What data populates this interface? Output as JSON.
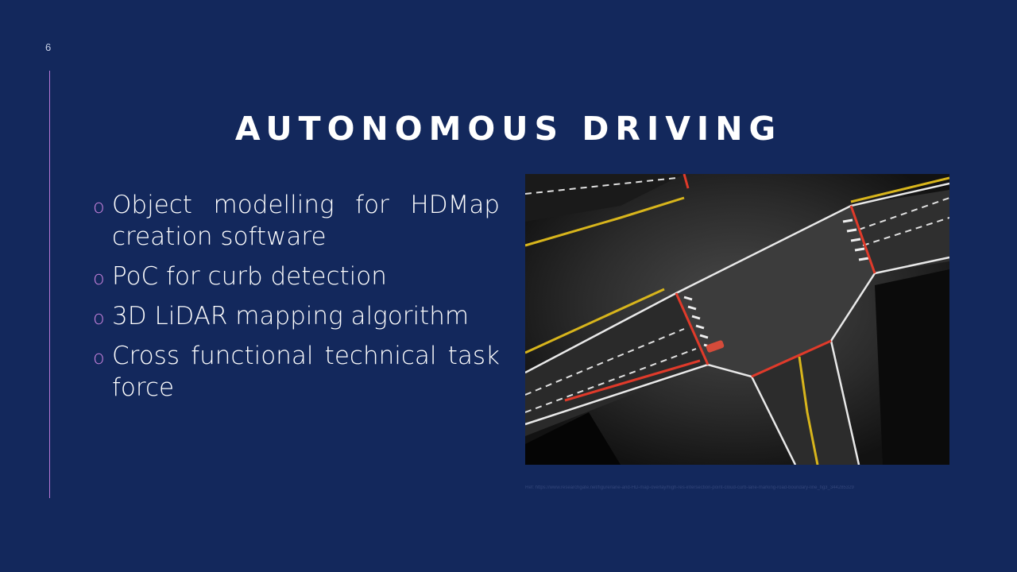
{
  "slide": {
    "page_number": "6",
    "title": "AUTONOMOUS DRIVING",
    "bullet_marker": "o",
    "bullets": [
      "Object modelling for HDMap creation software",
      "PoC for curb detection",
      "3D LiDAR mapping algorithm",
      "Cross functional technical task force"
    ],
    "reference": "Ref: https://www.researchgate.net/figure/lane-and-HD-map-overlay/high-res-intersection-point-cloud-curb-lane-marking-road-boundary-line_fig3_344285329"
  },
  "colors": {
    "background": "#13285c",
    "accent_line": "#b777d6",
    "bullet_marker": "#c17fd8",
    "text": "#ffffff",
    "lane_yellow": "#d8b51c",
    "curb_red": "#e03a2a"
  },
  "figure": {
    "description_icon": "lidar-intersection-map-image"
  }
}
